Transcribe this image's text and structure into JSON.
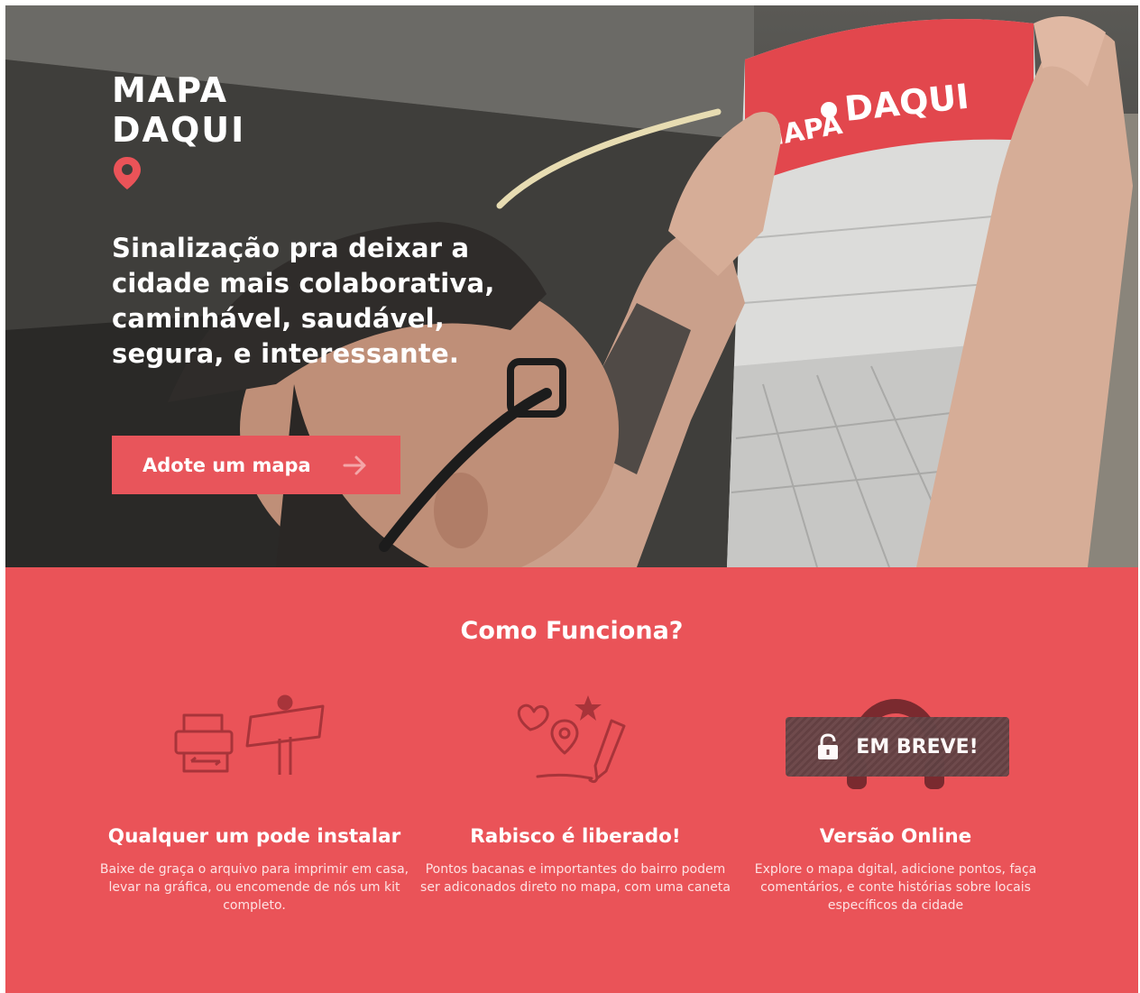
{
  "hero": {
    "logo_line1": "MAPA",
    "logo_line2": "DAQUI",
    "tagline_line1": "Sinalização pra deixar a",
    "tagline_line2": "cidade mais colaborativa,",
    "tagline_line3": "caminhável, saudável,",
    "tagline_line4": "segura, e interessante.",
    "cta_label": "Adote um mapa",
    "poster_brand_left": "MAPA",
    "poster_brand_right": "DAQUI"
  },
  "how": {
    "title": "Como Funciona?",
    "features": [
      {
        "title": "Qualquer um pode instalar",
        "text": "Baixe de graça o arquivo para imprimir em casa, levar na gráfica, ou encomende de nós um kit completo."
      },
      {
        "title": "Rabisco é liberado!",
        "text": "Pontos bacanas e importantes do bairro podem ser adiconados direto no mapa, com uma caneta"
      },
      {
        "title": "Versão Online",
        "text": "Explore o mapa dgital, adicione pontos, faça comentários, e conte histórias sobre locais específicos da cidade",
        "badge": "EM BREVE!"
      }
    ]
  },
  "colors": {
    "brand_red": "#ea5358",
    "cta_red": "#e8555b",
    "icon_dark": "#a8343a"
  },
  "icons": [
    "map-pin-icon",
    "arrow-right-icon",
    "printer-icon",
    "person-sign-icon",
    "heart-icon",
    "star-icon",
    "pencil-icon",
    "headphones-icon",
    "lock-icon"
  ]
}
